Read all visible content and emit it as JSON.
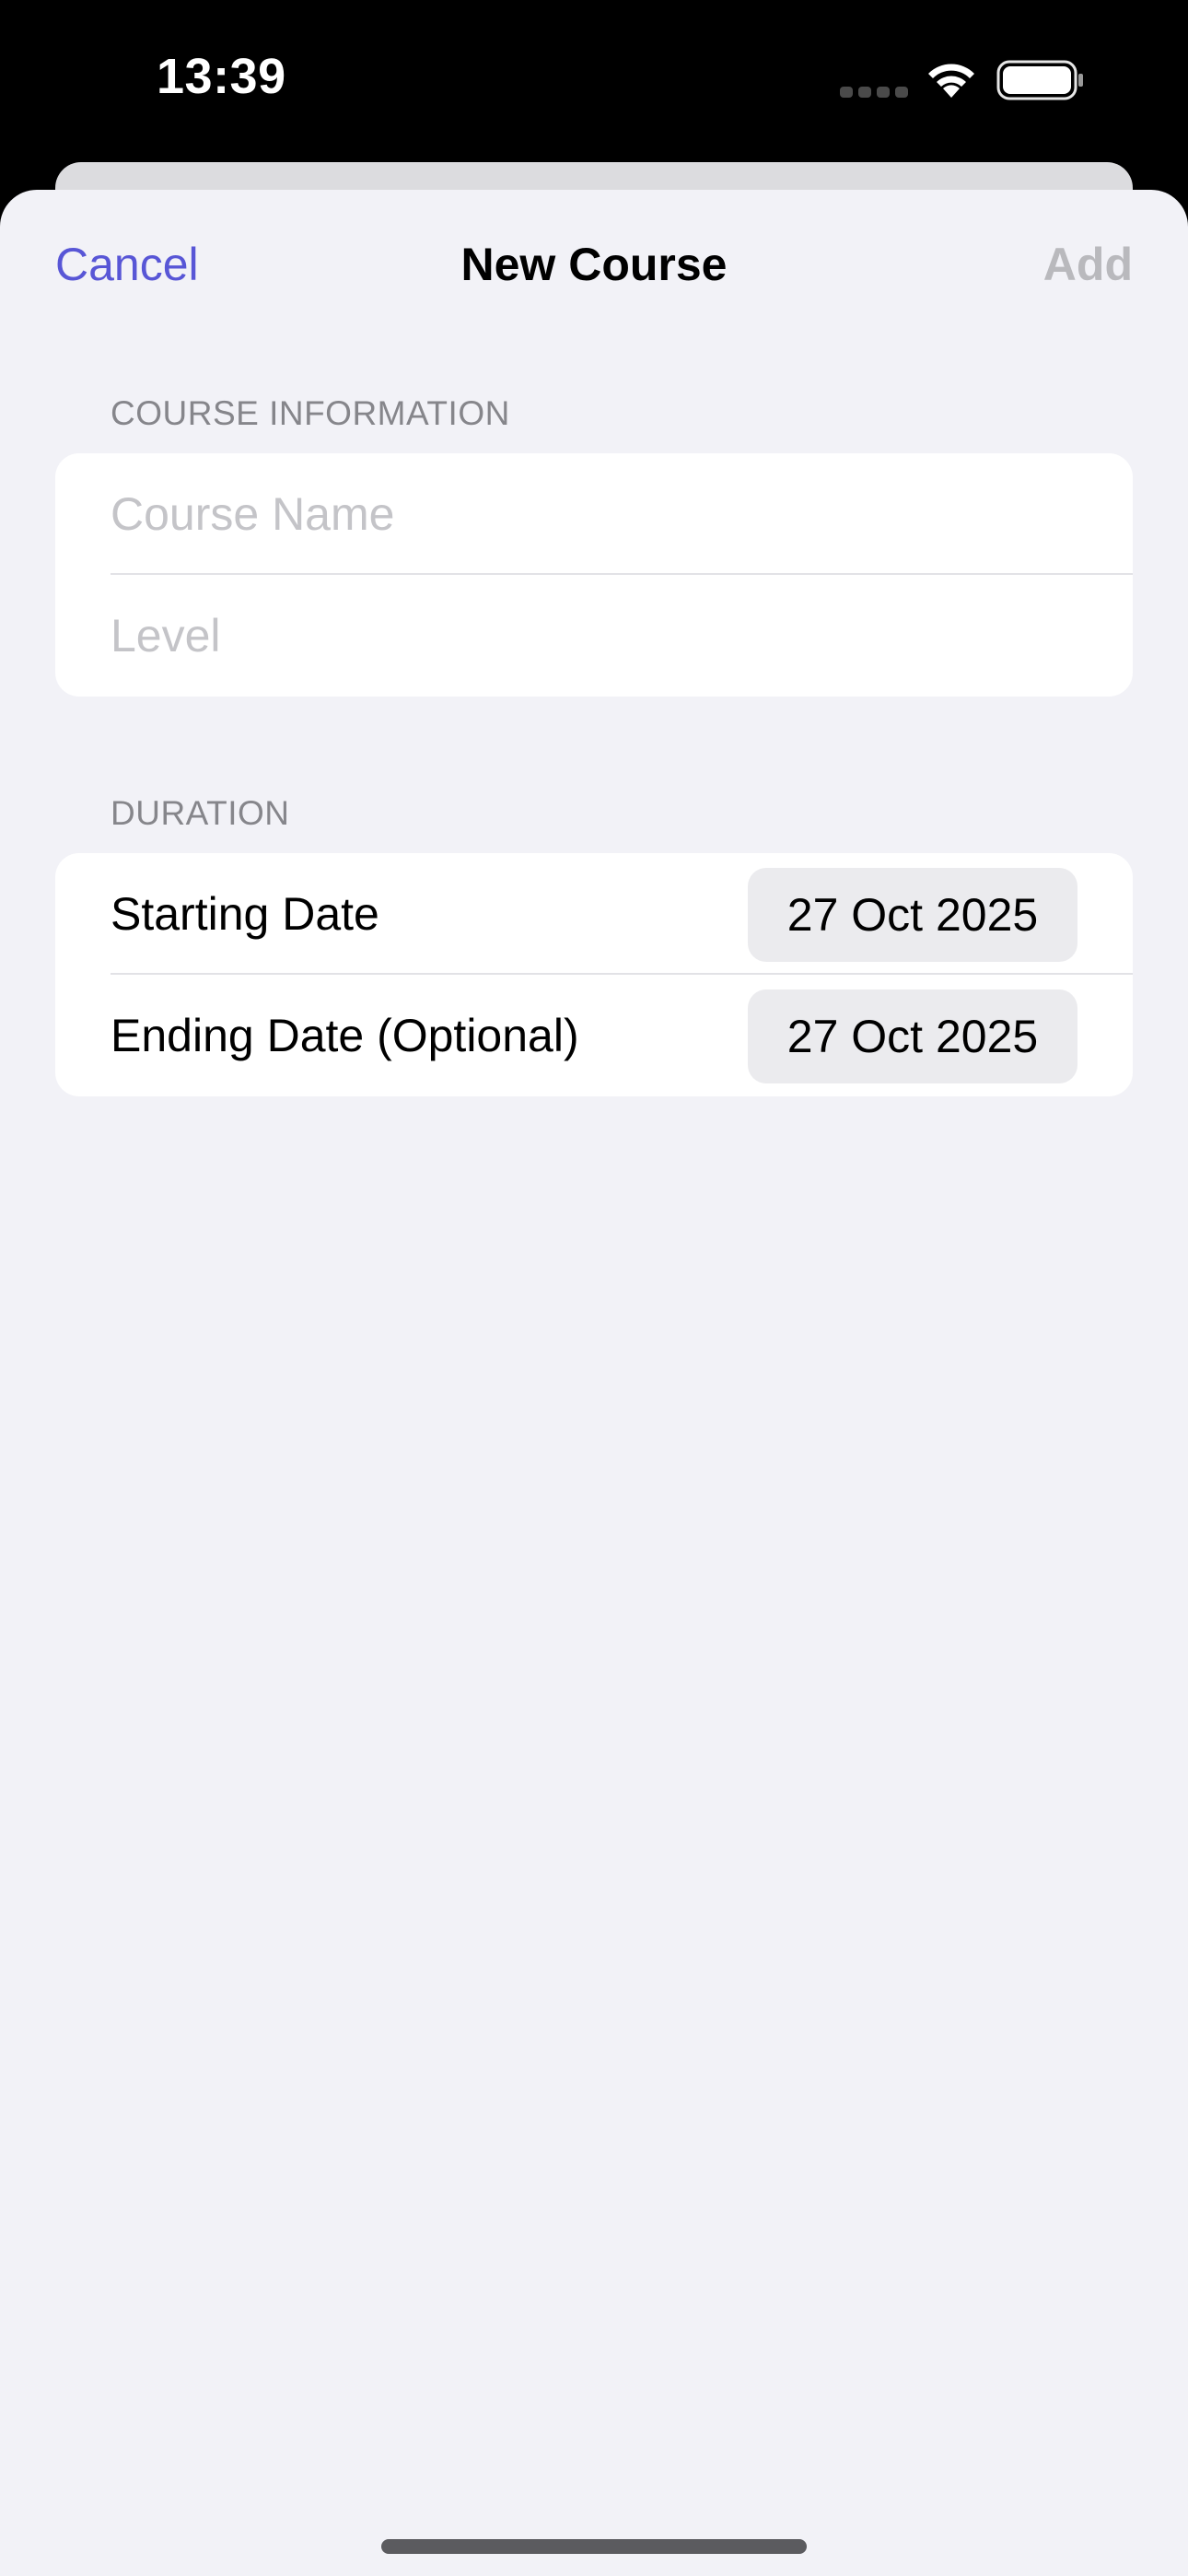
{
  "status_bar": {
    "time": "13:39",
    "icons": [
      "signal-dots-icon",
      "wifi-icon",
      "battery-icon"
    ]
  },
  "nav": {
    "cancel_label": "Cancel",
    "title": "New Course",
    "add_label": "Add"
  },
  "sections": {
    "course_info": {
      "header": "COURSE INFORMATION",
      "course_name_placeholder": "Course Name",
      "course_name_value": "",
      "level_placeholder": "Level",
      "level_value": ""
    },
    "duration": {
      "header": "DURATION",
      "starting_label": "Starting Date",
      "starting_value": "27 Oct 2025",
      "ending_label": "Ending Date (Optional)",
      "ending_value": "27 Oct 2025"
    }
  },
  "colors": {
    "accent": "#5856d6",
    "disabled": "#b9b9bd",
    "background": "#f2f2f7",
    "placeholder": "#c4c4c8"
  }
}
